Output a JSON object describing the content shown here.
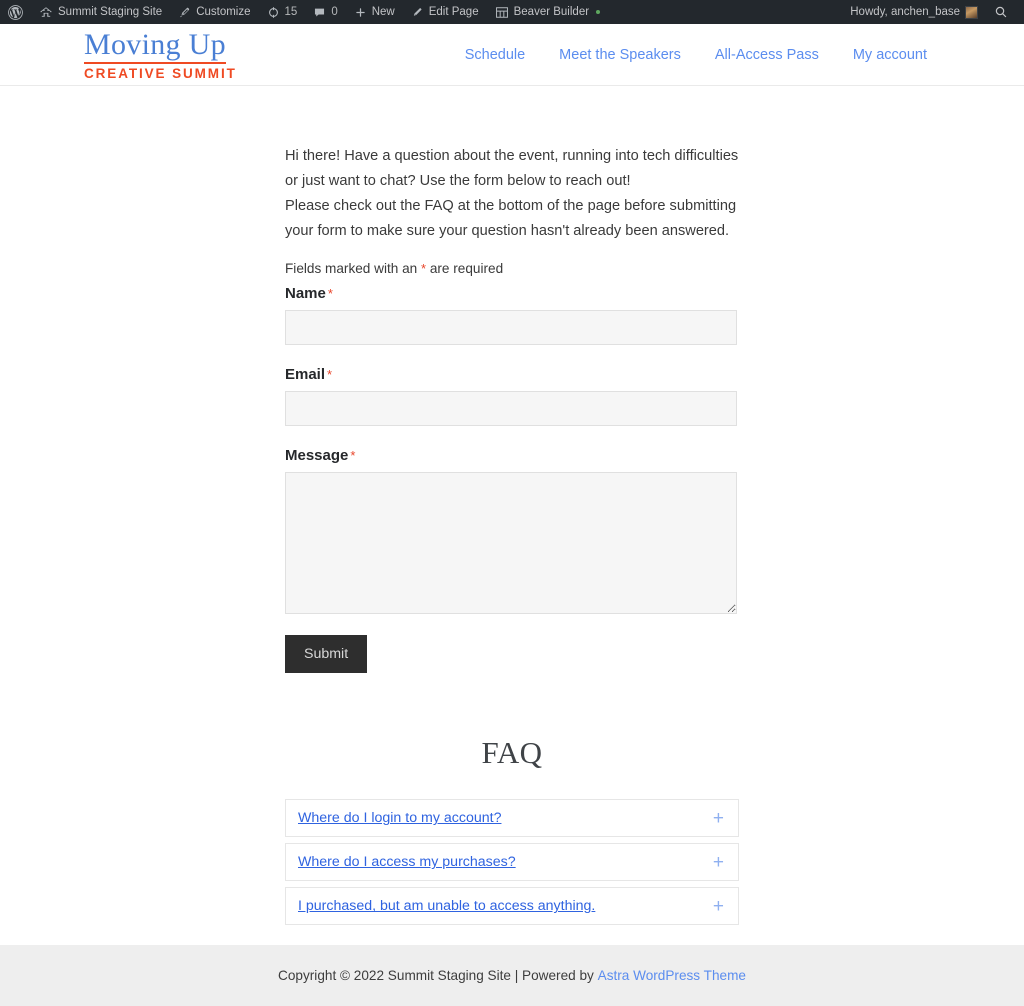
{
  "adminbar": {
    "wp_logo": "wordpress-logo",
    "site_name": "Summit Staging Site",
    "customize": "Customize",
    "updates_count": "15",
    "comments_count": "0",
    "new": "New",
    "edit_page": "Edit Page",
    "beaver_builder": "Beaver Builder",
    "howdy": "Howdy, anchen_base",
    "search": "search-icon"
  },
  "header": {
    "logo_top": "Moving Up",
    "logo_bottom": "CREATIVE SUMMIT",
    "nav": [
      {
        "label": "Schedule"
      },
      {
        "label": "Meet the Speakers"
      },
      {
        "label": "All-Access Pass"
      },
      {
        "label": "My account"
      }
    ]
  },
  "main": {
    "intro_line1": "Hi there! Have a question about the event, running into tech difficulties or just want to chat? Use the form below to reach out!",
    "intro_line2": "Please check out the FAQ at the bottom of the page before submitting your form to make sure your question hasn't already been answered.",
    "required_note_before": "Fields marked with an",
    "required_star": "*",
    "required_note_after": "are required",
    "form": {
      "name_label": "Name",
      "name_value": "",
      "name_placeholder": "",
      "email_label": "Email",
      "email_value": "",
      "email_placeholder": "",
      "message_label": "Message",
      "message_value": "",
      "message_placeholder": "",
      "required_marker": "*",
      "submit_label": "Submit"
    },
    "faq": {
      "title": "FAQ",
      "items": [
        {
          "question": "Where do I login to my account?",
          "toggle": "+"
        },
        {
          "question": "Where do I access my purchases?",
          "toggle": "+"
        },
        {
          "question": "I purchased, but am unable to access anything.",
          "toggle": "+"
        }
      ]
    }
  },
  "footer": {
    "copyright": "Copyright © 2022 Summit Staging Site | Powered by",
    "theme_link": "Astra WordPress Theme"
  },
  "colors": {
    "brand_blue": "#4a7fd4",
    "brand_orange": "#ef4a23",
    "nav_blue": "#5b8def",
    "link_blue": "#2f63e0",
    "required_red": "#e8452a",
    "adminbar_bg": "#23282d",
    "footer_bg": "#eeeeee",
    "submit_bg": "#2e2e2e"
  }
}
